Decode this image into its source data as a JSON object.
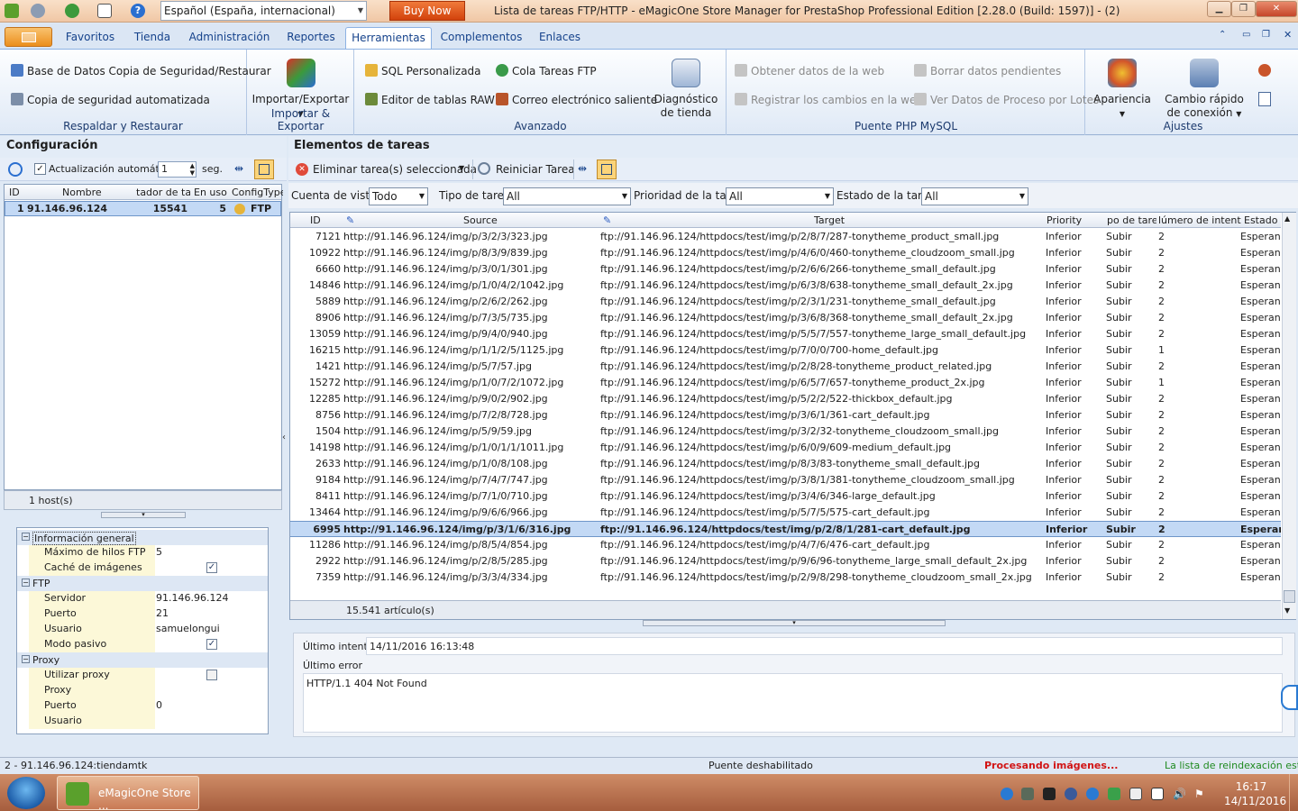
{
  "title_bar": {
    "language": "Español (España, internacional)",
    "buy_now": "Buy Now",
    "window_title": "Lista de tareas FTP/HTTP - eMagicOne Store Manager for PrestaShop Professional Edition [2.28.0 (Build: 1597)] - (2)"
  },
  "ribbon_tabs": [
    "Favoritos",
    "Tienda",
    "Administración",
    "Reportes",
    "Herramientas",
    "Complementos",
    "Enlaces"
  ],
  "ribbon": {
    "g1": {
      "b1": "Base de Datos Copia de Seguridad/Restaurar",
      "b2": "Copia de seguridad automatizada",
      "label": "Respaldar y Restaurar"
    },
    "g2": {
      "b1": "Importar/Exportar",
      "label": "Importar & Exportar"
    },
    "g3": {
      "b1": "SQL Personalizada",
      "b2": "Editor de tablas RAW",
      "b3": "Cola Tareas FTP",
      "b4": "Correo electrónico saliente",
      "b5a": "Diagnóstico",
      "b5b": "de tienda",
      "label": "Avanzado"
    },
    "g4": {
      "b1": "Obtener datos de la web",
      "b2": "Registrar los cambios en la web",
      "b3": "Borrar datos pendientes",
      "b4": "Ver Datos de Proceso por Lotes",
      "label": "Puente PHP MySQL"
    },
    "g5": {
      "b1": "Apariencia",
      "b2a": "Cambio rápido",
      "b2b": "de conexión",
      "label": "Ajustes"
    }
  },
  "left": {
    "title": "Configuración",
    "auto_update": "Actualización automática",
    "interval": "1",
    "interval_unit": "seg.",
    "columns": [
      "ID",
      "Nombre",
      "tador de tar",
      "En uso",
      "ConfigType"
    ],
    "row": {
      "id": "1",
      "name": "91.146.96.124",
      "count": "15541",
      "in_use": "5",
      "type": "FTP"
    },
    "footer": "1 host(s)"
  },
  "props": {
    "cat_general": "Información general",
    "max_threads_label": "Máximo de hilos FTP",
    "max_threads": "5",
    "image_cache_label": "Caché de imágenes",
    "cat_ftp": "FTP",
    "server_label": "Servidor",
    "server": "91.146.96.124",
    "port_label": "Puerto",
    "port": "21",
    "user_label": "Usuario",
    "user": "samuelongui",
    "passive_label": "Modo pasivo",
    "cat_proxy": "Proxy",
    "use_proxy_label": "Utilizar proxy",
    "proxy_label": "Proxy",
    "proxy_port_label": "Puerto",
    "proxy_port": "0",
    "proxy_user_label": "Usuario"
  },
  "right": {
    "title": "Elementos de tareas",
    "delete_btn": "Eliminar tarea(s) seleccionada",
    "restart_btn": "Reiniciar Tarea",
    "filters": {
      "views_label": "Cuenta de vistas",
      "views": "Todo",
      "type_label": "Tipo de tarea",
      "type": "All",
      "priority_label": "Prioridad de la tarea",
      "priority": "All",
      "state_label": "Estado de la tarea",
      "state": "All"
    },
    "columns": [
      "ID",
      "Source",
      "Target",
      "Priority",
      "po de tare",
      "lúmero de intentos",
      "Estado"
    ],
    "rows": [
      [
        "7121",
        "http://91.146.96.124/img/p/3/2/3/323.jpg",
        "ftp://91.146.96.124/httpdocs/test/img/p/2/8/7/287-tonytheme_product_small.jpg",
        "Inferior",
        "Subir",
        "2",
        "Esperanc"
      ],
      [
        "10922",
        "http://91.146.96.124/img/p/8/3/9/839.jpg",
        "ftp://91.146.96.124/httpdocs/test/img/p/4/6/0/460-tonytheme_cloudzoom_small.jpg",
        "Inferior",
        "Subir",
        "2",
        "Esperanc"
      ],
      [
        "6660",
        "http://91.146.96.124/img/p/3/0/1/301.jpg",
        "ftp://91.146.96.124/httpdocs/test/img/p/2/6/6/266-tonytheme_small_default.jpg",
        "Inferior",
        "Subir",
        "2",
        "Esperanc"
      ],
      [
        "14846",
        "http://91.146.96.124/img/p/1/0/4/2/1042.jpg",
        "ftp://91.146.96.124/httpdocs/test/img/p/6/3/8/638-tonytheme_small_default_2x.jpg",
        "Inferior",
        "Subir",
        "2",
        "Esperanc"
      ],
      [
        "5889",
        "http://91.146.96.124/img/p/2/6/2/262.jpg",
        "ftp://91.146.96.124/httpdocs/test/img/p/2/3/1/231-tonytheme_small_default.jpg",
        "Inferior",
        "Subir",
        "2",
        "Esperanc"
      ],
      [
        "8906",
        "http://91.146.96.124/img/p/7/3/5/735.jpg",
        "ftp://91.146.96.124/httpdocs/test/img/p/3/6/8/368-tonytheme_small_default_2x.jpg",
        "Inferior",
        "Subir",
        "2",
        "Esperanc"
      ],
      [
        "13059",
        "http://91.146.96.124/img/p/9/4/0/940.jpg",
        "ftp://91.146.96.124/httpdocs/test/img/p/5/5/7/557-tonytheme_large_small_default.jpg",
        "Inferior",
        "Subir",
        "2",
        "Esperanc"
      ],
      [
        "16215",
        "http://91.146.96.124/img/p/1/1/2/5/1125.jpg",
        "ftp://91.146.96.124/httpdocs/test/img/p/7/0/0/700-home_default.jpg",
        "Inferior",
        "Subir",
        "1",
        "Esperanc"
      ],
      [
        "1421",
        "http://91.146.96.124/img/p/5/7/57.jpg",
        "ftp://91.146.96.124/httpdocs/test/img/p/2/8/28-tonytheme_product_related.jpg",
        "Inferior",
        "Subir",
        "2",
        "Esperanc"
      ],
      [
        "15272",
        "http://91.146.96.124/img/p/1/0/7/2/1072.jpg",
        "ftp://91.146.96.124/httpdocs/test/img/p/6/5/7/657-tonytheme_product_2x.jpg",
        "Inferior",
        "Subir",
        "1",
        "Esperanc"
      ],
      [
        "12285",
        "http://91.146.96.124/img/p/9/0/2/902.jpg",
        "ftp://91.146.96.124/httpdocs/test/img/p/5/2/2/522-thickbox_default.jpg",
        "Inferior",
        "Subir",
        "2",
        "Esperanc"
      ],
      [
        "8756",
        "http://91.146.96.124/img/p/7/2/8/728.jpg",
        "ftp://91.146.96.124/httpdocs/test/img/p/3/6/1/361-cart_default.jpg",
        "Inferior",
        "Subir",
        "2",
        "Esperanc"
      ],
      [
        "1504",
        "http://91.146.96.124/img/p/5/9/59.jpg",
        "ftp://91.146.96.124/httpdocs/test/img/p/3/2/32-tonytheme_cloudzoom_small.jpg",
        "Inferior",
        "Subir",
        "2",
        "Esperanc"
      ],
      [
        "14198",
        "http://91.146.96.124/img/p/1/0/1/1/1011.jpg",
        "ftp://91.146.96.124/httpdocs/test/img/p/6/0/9/609-medium_default.jpg",
        "Inferior",
        "Subir",
        "2",
        "Esperanc"
      ],
      [
        "2633",
        "http://91.146.96.124/img/p/1/0/8/108.jpg",
        "ftp://91.146.96.124/httpdocs/test/img/p/8/3/83-tonytheme_small_default.jpg",
        "Inferior",
        "Subir",
        "2",
        "Esperanc"
      ],
      [
        "9184",
        "http://91.146.96.124/img/p/7/4/7/747.jpg",
        "ftp://91.146.96.124/httpdocs/test/img/p/3/8/1/381-tonytheme_cloudzoom_small.jpg",
        "Inferior",
        "Subir",
        "2",
        "Esperanc"
      ],
      [
        "8411",
        "http://91.146.96.124/img/p/7/1/0/710.jpg",
        "ftp://91.146.96.124/httpdocs/test/img/p/3/4/6/346-large_default.jpg",
        "Inferior",
        "Subir",
        "2",
        "Esperanc"
      ],
      [
        "13464",
        "http://91.146.96.124/img/p/9/6/6/966.jpg",
        "ftp://91.146.96.124/httpdocs/test/img/p/5/7/5/575-cart_default.jpg",
        "Inferior",
        "Subir",
        "2",
        "Esperanc"
      ],
      [
        "6995",
        "http://91.146.96.124/img/p/3/1/6/316.jpg",
        "ftp://91.146.96.124/httpdocs/test/img/p/2/8/1/281-cart_default.jpg",
        "Inferior",
        "Subir",
        "2",
        "Esperar"
      ],
      [
        "11286",
        "http://91.146.96.124/img/p/8/5/4/854.jpg",
        "ftp://91.146.96.124/httpdocs/test/img/p/4/7/6/476-cart_default.jpg",
        "Inferior",
        "Subir",
        "2",
        "Esperanc"
      ],
      [
        "2922",
        "http://91.146.96.124/img/p/2/8/5/285.jpg",
        "ftp://91.146.96.124/httpdocs/test/img/p/9/6/96-tonytheme_large_small_default_2x.jpg",
        "Inferior",
        "Subir",
        "2",
        "Esperanc"
      ],
      [
        "7359",
        "http://91.146.96.124/img/p/3/3/4/334.jpg",
        "ftp://91.146.96.124/httpdocs/test/img/p/2/9/8/298-tonytheme_cloudzoom_small_2x.jpg",
        "Inferior",
        "Subir",
        "2",
        "Esperanc"
      ]
    ],
    "footer": "15.541 artículo(s)"
  },
  "details": {
    "last_try_label": "Último intento",
    "last_try": "14/11/2016 16:13:48",
    "last_error_label": "Último error",
    "last_error": "HTTP/1.1 404 Not Found"
  },
  "status": {
    "connection": "2 - 91.146.96.124:tiendamtk",
    "bridge": "Puente deshabilitado",
    "processing": "Procesando imágenes...",
    "reindex": "La lista de reindexación está va"
  },
  "taskbar": {
    "app": "eMagicOne Store ...",
    "time": "16:17",
    "date": "14/11/2016"
  },
  "colors": {
    "accent": "#15428b",
    "processing": "#d11414",
    "reindex": "#1f8a1f",
    "selection": "#c3d9f5"
  }
}
